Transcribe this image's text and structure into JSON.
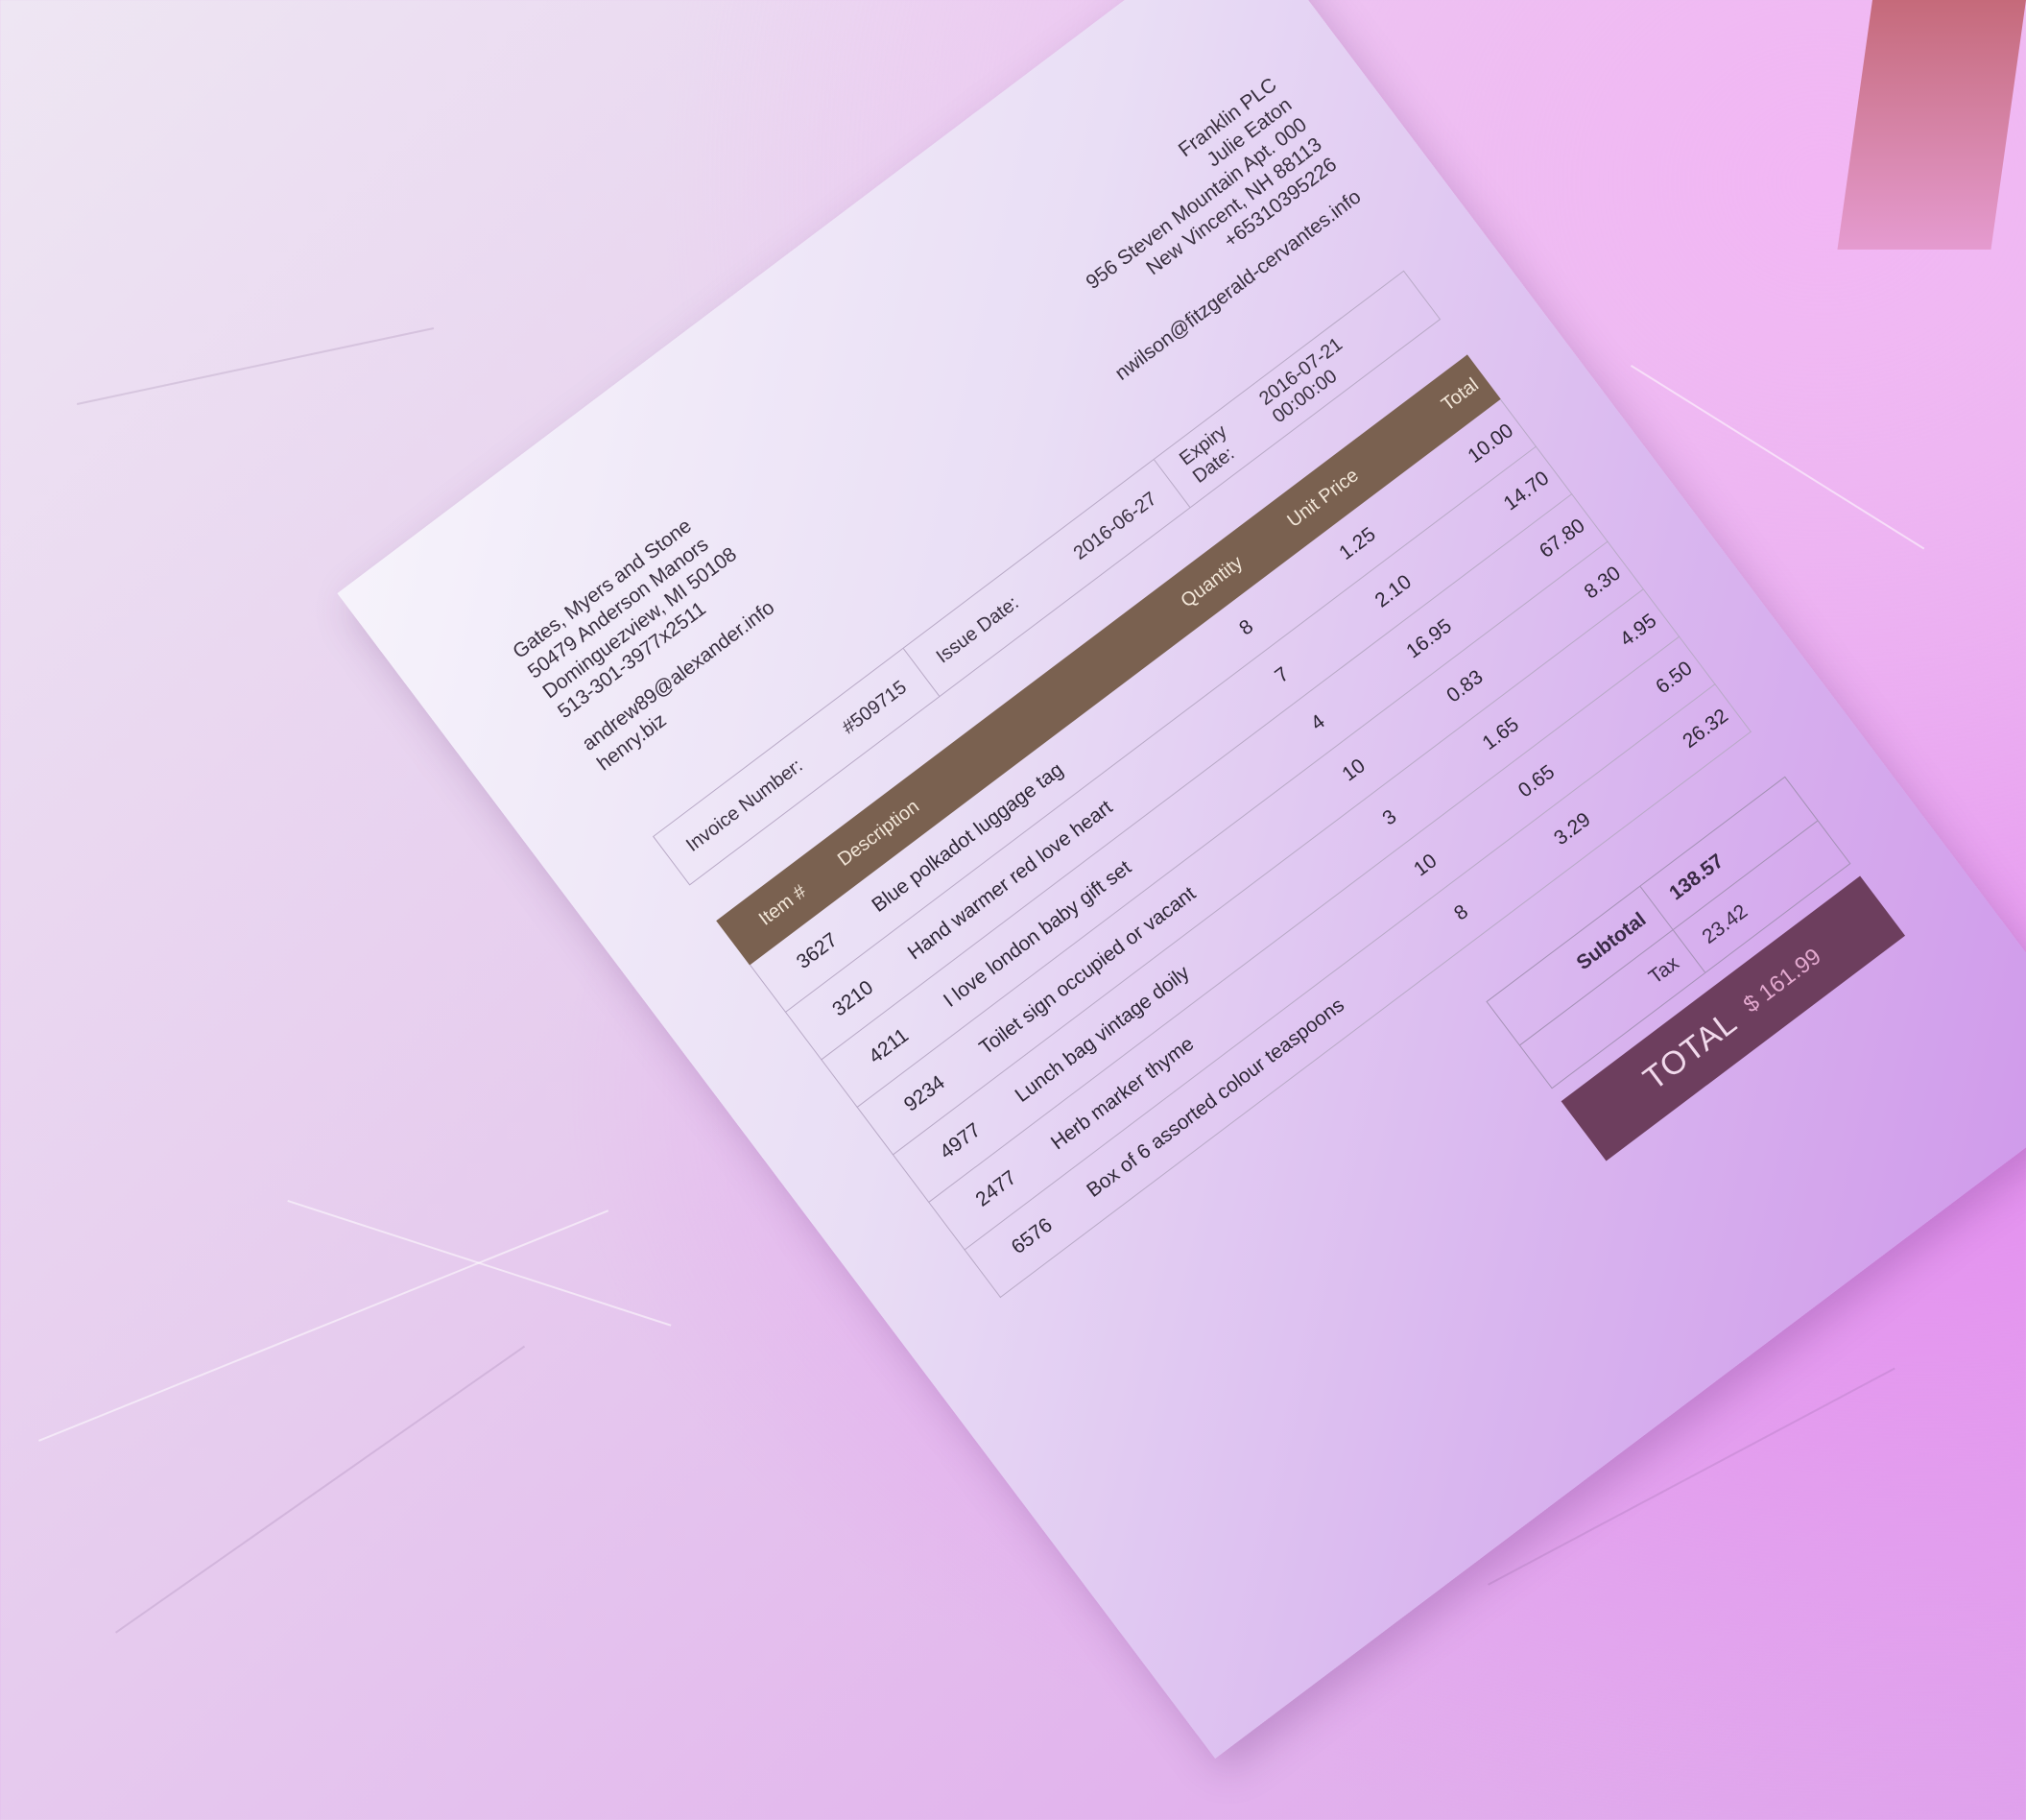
{
  "sender": {
    "company": "Gates, Myers and Stone",
    "street": "50479 Anderson Manors",
    "city": "Dominguezview, MI 50108",
    "phone": "513-301-3977x2511",
    "email_line1": "andrew89@alexander.info",
    "email_line2": "henry.biz"
  },
  "recipient": {
    "company": "Franklin PLC",
    "contact": "Julie Eaton",
    "street": "956 Steven Mountain Apt. 000",
    "city": "New Vincent, NH 88113",
    "phone": "+65310395226",
    "email": "nwilson@fitzgerald-cervantes.info"
  },
  "meta": {
    "invoice_label": "Invoice Number:",
    "invoice_value": "#509715",
    "issue_label": "Issue Date:",
    "issue_value": "2016-06-27",
    "expiry_label": "Expiry Date:",
    "expiry_value": "2016-07-21 00:00:00"
  },
  "table": {
    "headers": [
      "Item #",
      "Description",
      "Quantity",
      "Unit Price",
      "Total"
    ],
    "rows": [
      [
        "3627",
        "Blue polkadot luggage tag",
        "8",
        "1.25",
        "10.00"
      ],
      [
        "3210",
        "Hand warmer red love heart",
        "7",
        "2.10",
        "14.70"
      ],
      [
        "4211",
        "I love london baby gift set",
        "4",
        "16.95",
        "67.80"
      ],
      [
        "9234",
        "Toilet sign occupied or vacant",
        "10",
        "0.83",
        "8.30"
      ],
      [
        "4977",
        "Lunch bag vintage doily",
        "3",
        "1.65",
        "4.95"
      ],
      [
        "2477",
        "Herb marker thyme",
        "10",
        "0.65",
        "6.50"
      ],
      [
        "6576",
        "Box of 6 assorted colour teaspoons",
        "8",
        "3.29",
        "26.32"
      ]
    ]
  },
  "totals": {
    "subtotal_label": "Subtotal",
    "subtotal_value": "138.57",
    "tax_label": "Tax",
    "tax_value": "23.42",
    "total_label": "TOTAL",
    "total_value": "$ 161.99"
  }
}
